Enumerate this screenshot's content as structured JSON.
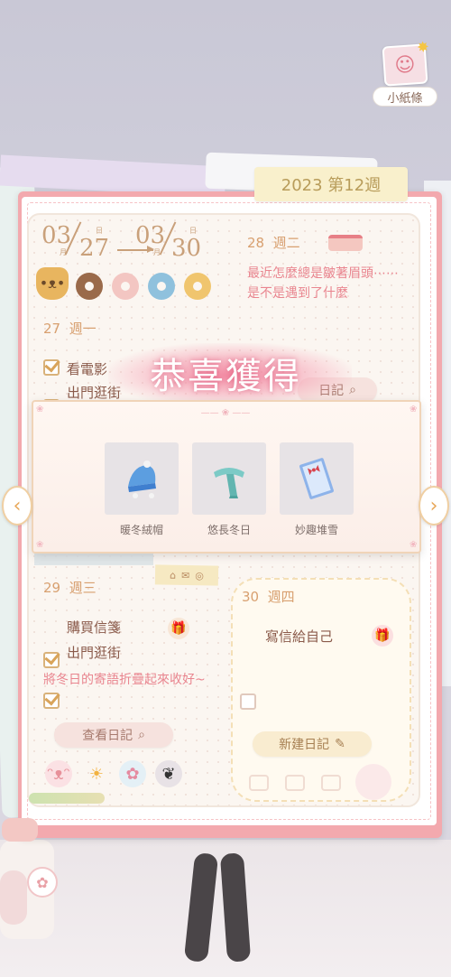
{
  "header": {
    "note_label": "小紙條",
    "week_tag": "2023 第12週"
  },
  "date_range": {
    "start_month": "03",
    "start_day": "27",
    "end_month": "03",
    "end_day": "30",
    "month_char": "月",
    "day_char": "日"
  },
  "days": {
    "d27": {
      "number": "27",
      "weekday": "週一",
      "todos": [
        "看電影",
        "出門逛街"
      ]
    },
    "d28": {
      "number": "28",
      "weekday": "週二",
      "note": "最近怎麼總是皺著眉頭⋯⋯是不是遇到了什麼"
    },
    "d29": {
      "number": "29",
      "weekday": "週三",
      "todos": [
        "購買信箋",
        "出門逛街"
      ],
      "note": "將冬日的寄語折疊起來收好~",
      "diary_button": "查看日記"
    },
    "d30": {
      "number": "30",
      "weekday": "週四",
      "todos": [
        "寫信給自己"
      ],
      "new_button": "新建日記"
    }
  },
  "hidden_button": "日記",
  "reward": {
    "title": "恭喜獲得",
    "items": [
      {
        "name": "暖冬絨帽",
        "icon": "blue-beanie-icon"
      },
      {
        "name": "悠長冬日",
        "icon": "teal-scarf-icon"
      },
      {
        "name": "妙趣堆雪",
        "icon": "letter-card-icon"
      }
    ]
  },
  "colors": {
    "board_pink": "#f3a9ae",
    "accent_brown": "#c9a07a",
    "text_pink": "#e9858f",
    "reward_glow": "#f27896"
  }
}
